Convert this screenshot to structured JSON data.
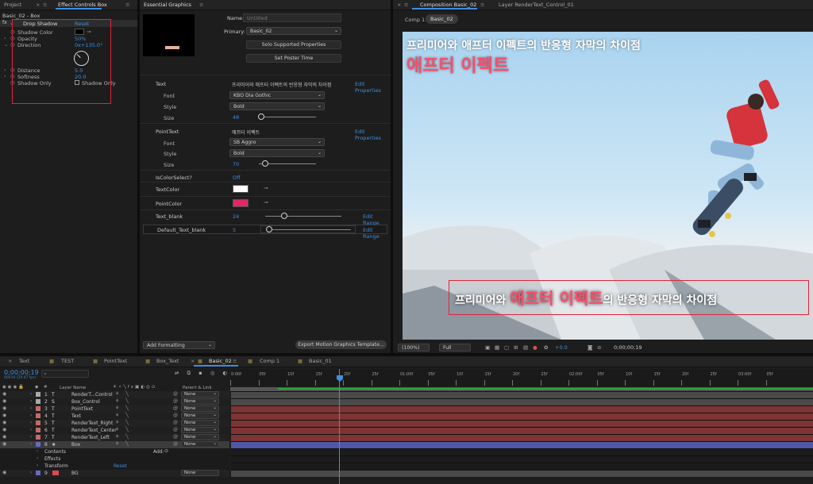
{
  "colors": {
    "accent": "#3d8fe0",
    "bar_red": "#7d3434",
    "bar_gray": "#4a4a4a",
    "bar_blue": "#5258a8",
    "label_red": "#e0243c",
    "text_color_swatch": "#ffffff",
    "point_color_swatch": "#e0276a"
  },
  "project_tab": "Project",
  "effect_controls": {
    "tab": "Effect Controls Box",
    "breadcrumb": "Basic_02 - Box",
    "effect_name": "Drop Shadow",
    "reset": "Reset",
    "fx": "fx",
    "props": [
      {
        "label": "Shadow Color",
        "value": ""
      },
      {
        "label": "Opacity",
        "value": "50%"
      },
      {
        "label": "Direction",
        "value": "0x+135.0°"
      },
      {
        "label": "Distance",
        "value": "5.0"
      },
      {
        "label": "Softness",
        "value": "20.0"
      },
      {
        "label": "Shadow Only",
        "value": "Shadow Only"
      }
    ]
  },
  "essential": {
    "tab": "Essential Graphics",
    "name_label": "Name:",
    "name_value": "Untitled",
    "primary_label": "Primary:",
    "primary_value": "Basic_02",
    "solo_btn": "Solo Supported Properties",
    "poster_btn": "Set Poster Time",
    "edit_props": "Edit Properties",
    "edit_range": "Edit Range",
    "text_section": {
      "label": "Text",
      "value": "프리미어와 애프터 이펙트의 반응형 자막의 차이점",
      "font_label": "Font",
      "font_value": "KBO Dia Gothic",
      "style_label": "Style",
      "style_value": "Bold",
      "size_label": "Size",
      "size_value": "48"
    },
    "point_section": {
      "label": "PointText",
      "value": "애프터 이펙트",
      "font_label": "Font",
      "font_value": "SB Aggro",
      "style_label": "Style",
      "style_value": "Bold",
      "size_label": "Size",
      "size_value": "70"
    },
    "iscolor": {
      "label": "IsColorSelect?",
      "value": "Off"
    },
    "textcolor_label": "TextColor",
    "pointcolor_label": "PointColor",
    "text_blank": {
      "label": "Text_blank",
      "value": "24"
    },
    "default_blank": {
      "label": "Default_Text_blank",
      "value": "5"
    },
    "add_formatting": "Add Formatting",
    "export_btn": "Export Motion Graphics Template..."
  },
  "composition": {
    "tab": "Composition Basic_02",
    "layer_tab": "Layer RenderText_Control_01",
    "breadcrumb_1": "Comp 1",
    "breadcrumb_2": "Basic_02",
    "title_line": "프리미어와 애프터 이펙트의 반응형 자막의 차이점",
    "title_big": "애프터 이펙트",
    "sub_pre": "프리미어와 ",
    "sub_point": "애프터 이펙트",
    "sub_post": "의 반응형 자막의 차이점",
    "zoom": "(100%)",
    "resolution": "Full",
    "exposure": "+0.0",
    "timecode": "0;00;00;19"
  },
  "timeline": {
    "tabs": [
      "Text",
      "TEST",
      "PointText",
      "Box_Text",
      "Basic_02",
      "Comp 1",
      "Basic_01"
    ],
    "active_tab": "Basic_02",
    "timecode": "0;00;00;19",
    "timecode_sub": "00019 (29.97 fps)",
    "search_placeholder": "",
    "col_layer_name": "Layer Name",
    "col_parent": "Parent & Link",
    "ruler_labels": [
      "0:00f",
      "05f",
      "10f",
      "15f",
      "20f",
      "25f",
      "01:00f",
      "05f",
      "10f",
      "15f",
      "20f",
      "25f",
      "02:00f",
      "05f",
      "10f",
      "15f",
      "20f",
      "25f",
      "03:00f",
      "05f"
    ],
    "layers": [
      {
        "num": "1",
        "type": "T",
        "name": "RenderT...Control",
        "parent": "None",
        "bar": "gray"
      },
      {
        "num": "2",
        "type": "S",
        "name": "Box_Control",
        "parent": "None",
        "bar": "gray"
      },
      {
        "num": "3",
        "type": "T",
        "name": "PointText",
        "parent": "None",
        "bar": "red"
      },
      {
        "num": "4",
        "type": "T",
        "name": "Text",
        "parent": "None",
        "bar": "red"
      },
      {
        "num": "5",
        "type": "T",
        "name": "RenderText_Right",
        "parent": "None",
        "bar": "red"
      },
      {
        "num": "6",
        "type": "T",
        "name": "RenderText_Center",
        "parent": "None",
        "bar": "red"
      },
      {
        "num": "7",
        "type": "T",
        "name": "RenderText_Left",
        "parent": "None",
        "bar": "red"
      },
      {
        "num": "8",
        "type": "★",
        "name": "Box",
        "parent": "None",
        "bar": "blue"
      }
    ],
    "sub_rows": [
      "Contents",
      "Effects",
      "Transform"
    ],
    "add_label": "Add:",
    "reset_label": "Reset",
    "bg_layer": {
      "num": "9",
      "name": "BG",
      "parent": "None"
    }
  }
}
